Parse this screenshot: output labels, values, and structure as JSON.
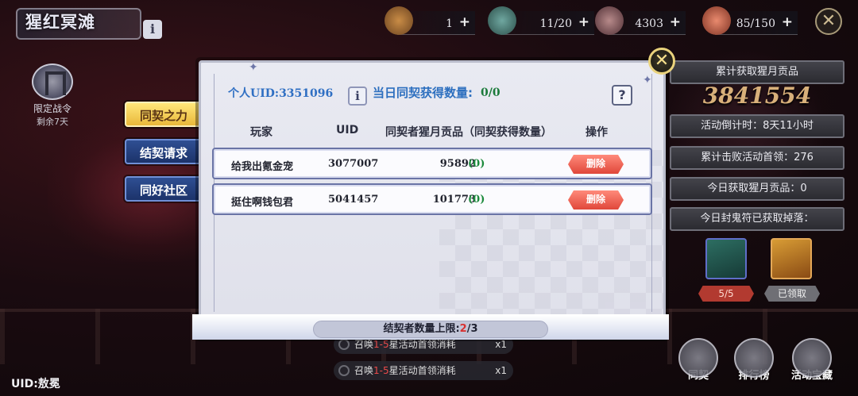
{
  "header": {
    "title": "猩红冥滩",
    "info_label": "i",
    "resources": [
      {
        "value": "1",
        "plus": "+"
      },
      {
        "value": "11/20",
        "plus": "+"
      },
      {
        "value": "4303",
        "plus": "+"
      },
      {
        "value": "85/150",
        "plus": "+"
      }
    ],
    "close_label": "✕"
  },
  "battle_pass": {
    "label": "限定战令",
    "remaining": "剩余7天"
  },
  "side_tabs": [
    {
      "label": "同契之力",
      "active": true
    },
    {
      "label": "结契请求",
      "active": false
    },
    {
      "label": "同好社区",
      "active": false
    }
  ],
  "right_panel": {
    "total_label": "累计获取猩月贡品",
    "total_value": "3841554",
    "countdown": "活动倒计时：8天11小时",
    "defeat": "累计击败活动首领：276",
    "today_gain": "今日获取猩月贡品：0",
    "today_drop": "今日封鬼符已获取掉落：",
    "reward1_tag": "5/5",
    "reward2_tag": "已领取"
  },
  "bottom_buttons": [
    {
      "label": "同契"
    },
    {
      "label": "排行榜"
    },
    {
      "label": "活动宝藏"
    }
  ],
  "bottom_uid": "UID:敖冕",
  "tasks": [
    {
      "prefix": "召唤",
      "highlight": "1-5",
      "suffix": "星活动首领消耗",
      "multiplier": "x1"
    },
    {
      "prefix": "召唤",
      "highlight": "1-5",
      "suffix": "星活动首领消耗",
      "multiplier": "x1"
    }
  ],
  "dialog": {
    "self_uid": "个人UID:3351096",
    "daily_label": "当日同契获得数量:",
    "daily_value": "0/0",
    "info_label": "i",
    "help_label": "?",
    "columns": {
      "player": "玩家",
      "uid": "UID",
      "count": "同契者猩月贡品（同契获得数量）",
      "action": "操作"
    },
    "rows": [
      {
        "name": "给我出氪金宠",
        "uid": "3077007",
        "count": "95892",
        "gained": "(0)",
        "action": "删除"
      },
      {
        "name": "挺住啊钱包君",
        "uid": "5041457",
        "count": "101773",
        "gained": "(0)",
        "action": "删除"
      }
    ],
    "limit_prefix": "结契者数量上限:",
    "limit_current": "2",
    "limit_max": "/3",
    "close_label": "✕"
  },
  "colors": {
    "accent_blue": "#2f6fc3",
    "delete_red": "#e0473a",
    "gold": "#d8b07a"
  }
}
